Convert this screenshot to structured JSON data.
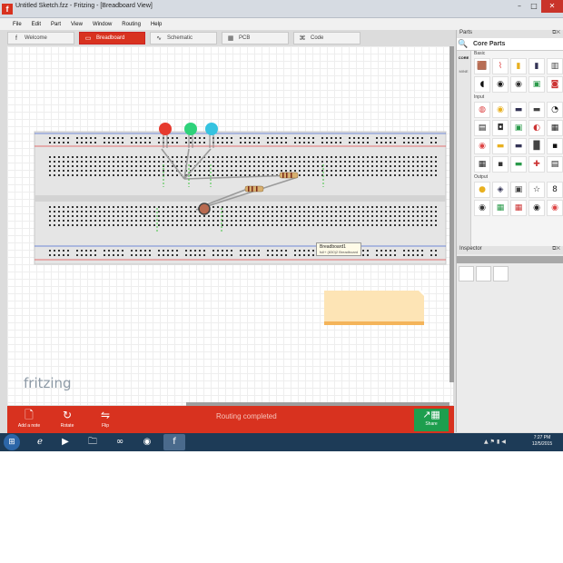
{
  "window": {
    "title": "Untitled Sketch.fzz - Fritzing - [Breadboard View]"
  },
  "menu": [
    "File",
    "Edit",
    "Part",
    "View",
    "Window",
    "Routing",
    "Help"
  ],
  "tabs": [
    {
      "label": "Welcome",
      "icon": "f"
    },
    {
      "label": "Breadboard",
      "icon": "▭"
    },
    {
      "label": "Schematic",
      "icon": "∿"
    },
    {
      "label": "PCB",
      "icon": "▦"
    },
    {
      "label": "Code",
      "icon": "⌘"
    }
  ],
  "active_tab": "Breadboard",
  "canvas": {
    "logo": "fritzing",
    "tooltip": {
      "title": "Breadboard1",
      "subtitle": "full+ (830)2 Breadboard"
    },
    "led_colors": [
      "#e63a2e",
      "#2ed27a",
      "#36c3e0"
    ],
    "breadboard_color": "#e5e5e5",
    "rail_red": "#e04a4a",
    "rail_blue": "#4a6ad0"
  },
  "toolbar": {
    "add_note": "Add a note",
    "rotate": "Rotate",
    "flip": "Flip",
    "status": "Routing completed",
    "share": "Share"
  },
  "parts": {
    "header": "Parts",
    "bin_title": "Core Parts",
    "bin_tabs": [
      "CORE",
      "MINE",
      "",
      "",
      "",
      "",
      "",
      "",
      "",
      "",
      "",
      "",
      "",
      "",
      ""
    ],
    "sections": [
      {
        "label": "Basic",
        "items": [
          "🟫",
          "⌇",
          "▮",
          "▮",
          "▥",
          "◖",
          "◉",
          "◉",
          "▣",
          "◙"
        ]
      },
      {
        "label": "Input",
        "items": [
          "◍",
          "◉",
          "▬",
          "▬",
          "◔",
          "▤",
          "◘",
          "▣",
          "◐",
          "▦",
          "◉",
          "▬",
          "▬",
          "█",
          "▪",
          "▦",
          "▪",
          "▬",
          "✚",
          "▤"
        ]
      },
      {
        "label": "Output",
        "items": [
          "●",
          "◈",
          "▣",
          "☆",
          "8",
          "◉",
          "▦",
          "▦",
          "◉",
          "◉"
        ]
      }
    ]
  },
  "inspector": {
    "header": "Inspector"
  },
  "taskbar": {
    "time": "7:27 PM",
    "date": "12/5/2015"
  }
}
